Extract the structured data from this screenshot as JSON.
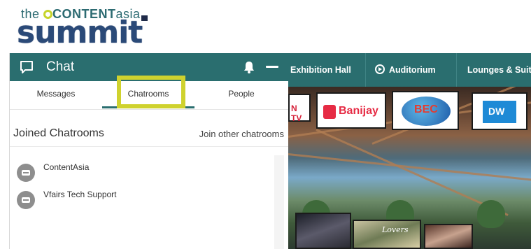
{
  "logo": {
    "prefix": "the",
    "brand_1": "CONTENT",
    "brand_2": "asia",
    "main": "summit"
  },
  "chat": {
    "title": "Chat",
    "tabs": {
      "messages": "Messages",
      "chatrooms": "Chatrooms",
      "people": "People"
    },
    "section_title": "Joined Chatrooms",
    "join_link": "Join other chatrooms",
    "rooms": [
      {
        "name": "ContentAsia"
      },
      {
        "name": "Vfairs Tech Support"
      }
    ]
  },
  "nav": {
    "items": [
      {
        "label": "Exhibition Hall"
      },
      {
        "label": "Auditorium",
        "icon": "play-circle-icon"
      },
      {
        "label": "Lounges & Suit"
      }
    ]
  },
  "scene": {
    "sponsors": [
      "N TV",
      "Banijay",
      "BEC",
      "DW"
    ],
    "poster_text": "Lovers"
  },
  "colors": {
    "accent": "#2a6e6f",
    "highlight": "#cfd22e"
  }
}
